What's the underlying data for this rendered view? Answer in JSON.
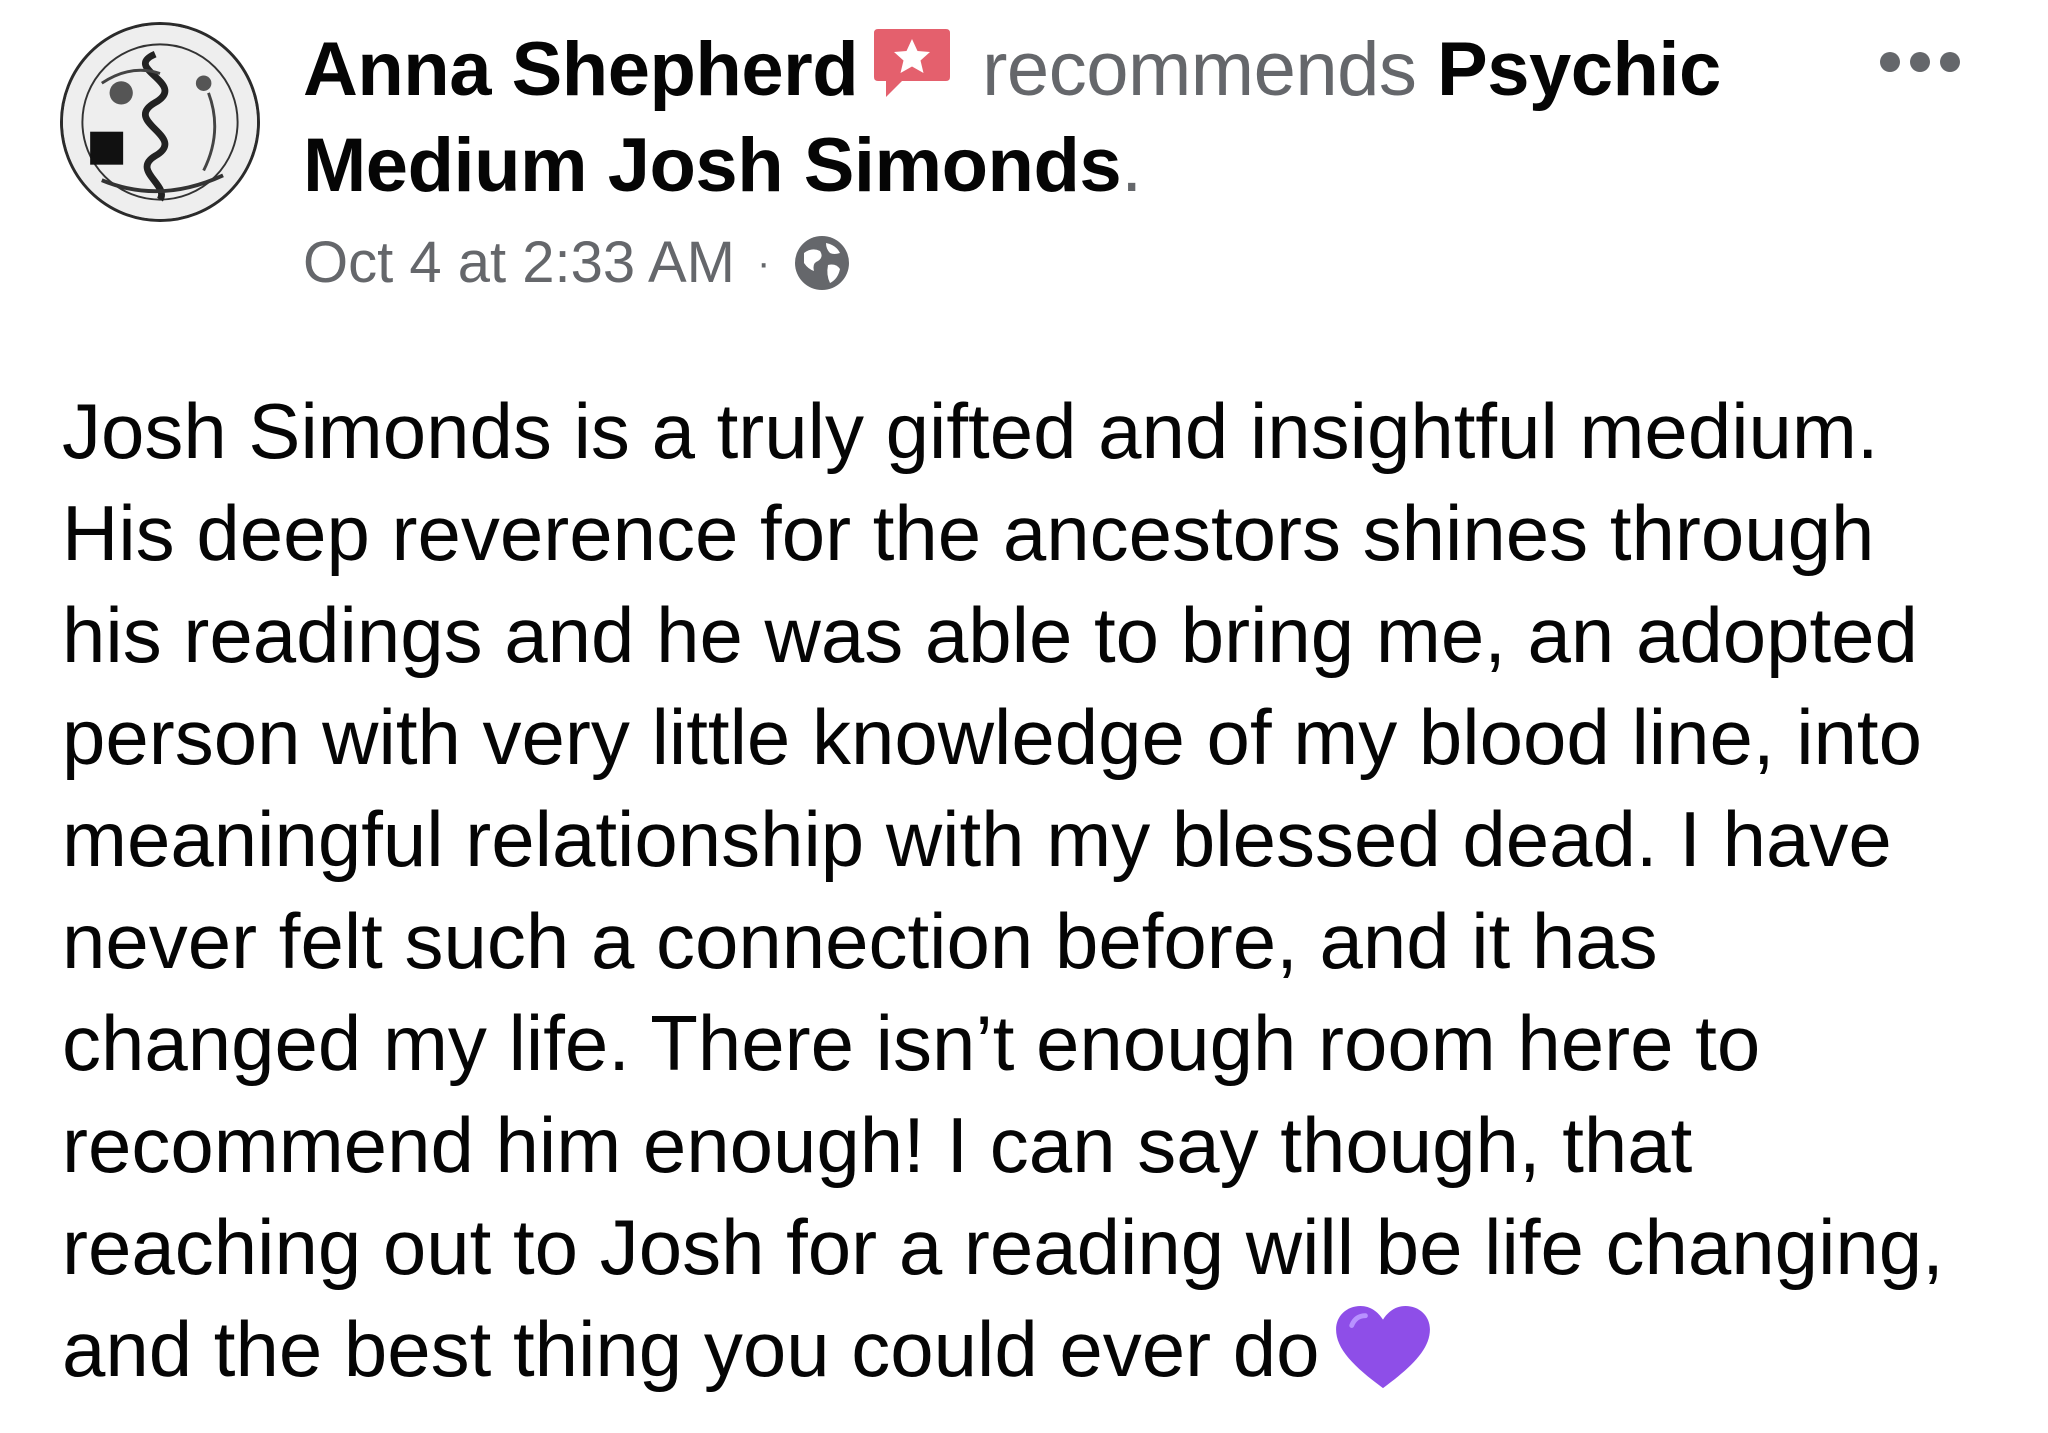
{
  "post": {
    "author_name": "Anna Shepherd",
    "recommends_text": "recommends",
    "page_name_line1": "Psychic",
    "page_name_line2": "Medium Josh Simonds",
    "period": ".",
    "timestamp": "Oct 4 at 2:33 AM",
    "separator": "·",
    "audience_icon": "globe-icon",
    "badge_icon": "recommendation-star-icon",
    "more_icon": "more-options-icon",
    "body_lines": [
      "Josh Simonds is a truly gifted and insightful medium.",
      "His deep reverence for the ancestors shines through",
      "his readings and he was able to bring me, an adopted",
      "person with very little knowledge of my blood line, into",
      "meaningful relationship with my blessed dead. I have",
      "never felt such a connection before, and it has",
      "changed my life. There isn’t enough room here to",
      "recommend him enough! I can say though, that",
      "reaching out to Josh for a reading will be life changing,",
      "and the best thing you could ever do"
    ],
    "end_emoji": "purple-heart-icon"
  },
  "colors": {
    "text_primary": "#050505",
    "text_secondary": "#65676b",
    "badge": "#e4606d",
    "heart": "#8e4ee8"
  }
}
